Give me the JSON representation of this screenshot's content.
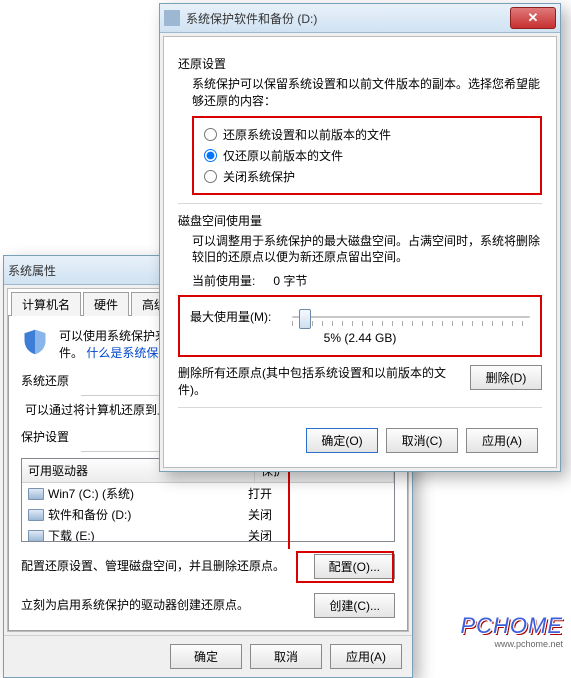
{
  "back": {
    "title": "系统属性",
    "tabs": [
      "计算机名",
      "硬件",
      "高级"
    ],
    "intro": "可以使用系统保护来撤销不需要的系统更改并还原以前版本的文件。",
    "intro_link": "什么是系统保护?",
    "group_restore": {
      "label": "系统还原",
      "text": "可以通过将计算机还原到上一个还原点，撤消系统更改。"
    },
    "group_protect": {
      "label": "保护设置",
      "header_drive": "可用驱动器",
      "header_prot": "保护",
      "rows": [
        {
          "name": "Win7 (C:) (系统)",
          "prot": "打开"
        },
        {
          "name": "软件和备份 (D:)",
          "prot": "关闭"
        },
        {
          "name": "下载 (E:)",
          "prot": "关闭"
        }
      ],
      "cfg_text": "配置还原设置、管理磁盘空间，并且删除还原点。",
      "cfg_btn": "配置(O)...",
      "create_text": "立刻为启用系统保护的驱动器创建还原点。",
      "create_btn": "创建(C)..."
    },
    "ok": "确定",
    "cancel": "取消",
    "apply": "应用(A)"
  },
  "front": {
    "title": "系统保护软件和备份 (D:)",
    "sect_restore": {
      "label": "还原设置",
      "text": "系统保护可以保留系统设置和以前文件版本的副本。选择您希望能够还原的内容：",
      "opts": [
        "还原系统设置和以前版本的文件",
        "仅还原以前版本的文件",
        "关闭系统保护"
      ],
      "selected": 1
    },
    "sect_disk": {
      "label": "磁盘空间使用量",
      "text": "可以调整用于系统保护的最大磁盘空间。占满空间时，系统将删除较旧的还原点以便为新还原点留出空间。",
      "current_label": "当前使用量:",
      "current_value": "0 字节",
      "max_label": "最大使用量(M):",
      "slider_value": "5% (2.44 GB)",
      "slider_percent": 5
    },
    "del_text": "删除所有还原点(其中包括系统设置和以前版本的文件)。",
    "del_btn": "删除(D)",
    "ok": "确定(O)",
    "cancel": "取消(C)",
    "apply": "应用(A)"
  },
  "watermark": {
    "brand": "PCHOME",
    "url": "www.pchome.net"
  }
}
